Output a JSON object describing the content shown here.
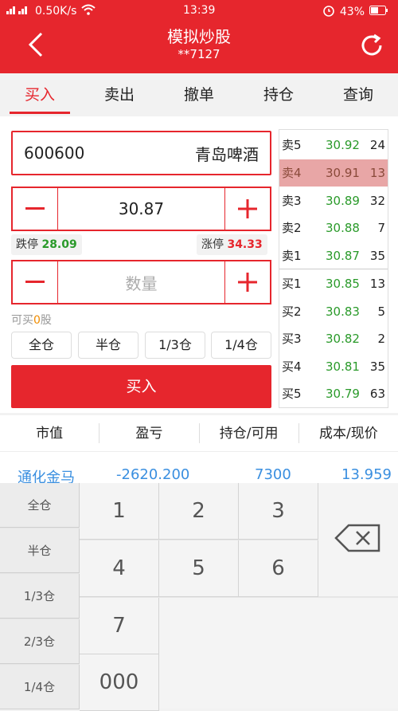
{
  "status_bar": {
    "network": "0.50K/s",
    "time": "13:39",
    "battery": "43%"
  },
  "header": {
    "title": "模拟炒股",
    "account": "**7127"
  },
  "tabs": [
    {
      "label": "买入",
      "active": true
    },
    {
      "label": "卖出"
    },
    {
      "label": "撤单"
    },
    {
      "label": "持仓"
    },
    {
      "label": "查询"
    }
  ],
  "order": {
    "stock_code": "600600",
    "stock_name": "青岛啤酒",
    "price": "30.87",
    "limit_down_label": "跌停",
    "limit_down_value": "28.09",
    "limit_up_label": "涨停",
    "limit_up_value": "34.33",
    "quantity_placeholder": "数量",
    "available_prefix": "可买",
    "available_count": "0",
    "available_suffix": "股",
    "position_buttons": [
      "全仓",
      "半仓",
      "1/3仓",
      "1/4仓"
    ],
    "submit_label": "买入"
  },
  "order_book": [
    {
      "label": "卖5",
      "price": "30.92",
      "volume": "24"
    },
    {
      "label": "卖4",
      "price": "30.91",
      "volume": "13",
      "highlight": true
    },
    {
      "label": "卖3",
      "price": "30.89",
      "volume": "32"
    },
    {
      "label": "卖2",
      "price": "30.88",
      "volume": "7"
    },
    {
      "label": "卖1",
      "price": "30.87",
      "volume": "35"
    },
    {
      "label": "买1",
      "price": "30.85",
      "volume": "13"
    },
    {
      "label": "买2",
      "price": "30.83",
      "volume": "5"
    },
    {
      "label": "买3",
      "price": "30.82",
      "volume": "2"
    },
    {
      "label": "买4",
      "price": "30.81",
      "volume": "35"
    },
    {
      "label": "买5",
      "price": "30.79",
      "volume": "63"
    }
  ],
  "holdings": {
    "columns": [
      "市值",
      "盈亏",
      "持仓/可用",
      "成本/现价"
    ],
    "rows": [
      {
        "name": "通化金马",
        "pnl": "-2620.200",
        "shares": "7300",
        "cost": "13.959"
      }
    ]
  },
  "keypad": {
    "side_keys": [
      "全仓",
      "半仓",
      "1/3仓",
      "2/3仓",
      "1/4仓"
    ],
    "keys": [
      "1",
      "2",
      "3",
      "4",
      "5",
      "6",
      "7",
      "000"
    ]
  },
  "colors": {
    "brand": "#e6262d",
    "down": "#2a9a2a",
    "up": "#e6262d",
    "link": "#3a8fe0"
  }
}
